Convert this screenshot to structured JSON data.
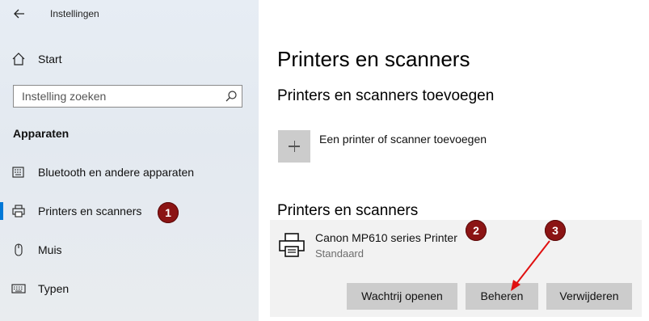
{
  "window": {
    "title": "Instellingen"
  },
  "sidebar": {
    "start_label": "Start",
    "search": {
      "placeholder": "Instelling zoeken"
    },
    "section_heading": "Apparaten",
    "items": [
      {
        "label": "Bluetooth en andere apparaten",
        "icon": "bluetooth-keyboard-icon"
      },
      {
        "label": "Printers en scanners",
        "icon": "printer-icon",
        "active": true
      },
      {
        "label": "Muis",
        "icon": "mouse-icon"
      },
      {
        "label": "Typen",
        "icon": "keyboard-icon"
      }
    ]
  },
  "main": {
    "title": "Printers en scanners",
    "add_section_title": "Printers en scanners toevoegen",
    "add_label": "Een printer of scanner toevoegen",
    "list_section_title": "Printers en scanners",
    "printer": {
      "name": "Canon MP610 series Printer",
      "status": "Standaard"
    },
    "buttons": {
      "queue": "Wachtrij openen",
      "manage": "Beheren",
      "remove": "Verwijderen"
    }
  },
  "annotations": {
    "step1": "1",
    "step2": "2",
    "step3": "3"
  },
  "colors": {
    "accent": "#0078d7",
    "badge": "#8b1414",
    "arrow": "#e01010"
  }
}
